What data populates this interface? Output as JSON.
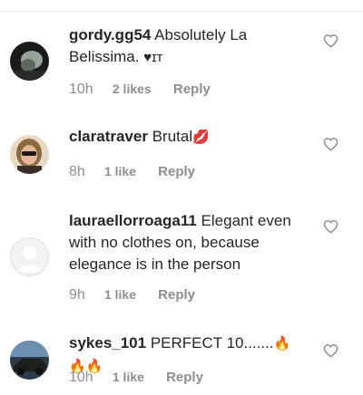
{
  "comments": [
    {
      "username": "gordy.gg54",
      "text": "Absolutely La Belissima.",
      "suffix": "♥ɪᴛ",
      "time": "10h",
      "likes": "2 likes",
      "reply": "Reply"
    },
    {
      "username": "claratraver",
      "text": "Brutal",
      "suffix": "💋",
      "time": "8h",
      "likes": "1 like",
      "reply": "Reply"
    },
    {
      "username": "lauraellorroaga11",
      "text": "Elegant even with no clothes on, because elegance is in the person",
      "time": "9h",
      "likes": "1 like",
      "reply": "Reply"
    },
    {
      "username": "sykes_101",
      "text": "PERFECT 10.......",
      "suffix": "🔥🔥🔥",
      "time": "10h",
      "likes": "1 like",
      "reply": "Reply"
    }
  ],
  "icons": {
    "like": "heart-outline-icon",
    "avatar_placeholder": "default-avatar-icon"
  },
  "colors": {
    "meta_text": "#8e8e8e",
    "heart_stroke": "#8e8e8e",
    "lips": "#d3262b",
    "fire": "#f0631a"
  }
}
